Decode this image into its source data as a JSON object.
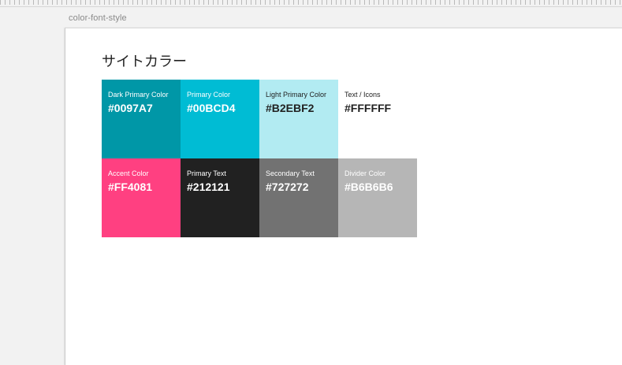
{
  "canvas": {
    "label": "color-font-style"
  },
  "artboard": {
    "title": "サイトカラー"
  },
  "swatches": [
    {
      "name": "Dark Primary Color",
      "hex": "#0097A7",
      "color": "#0097A7"
    },
    {
      "name": "Primary Color",
      "hex": "#00BCD4",
      "color": "#00BCD4"
    },
    {
      "name": "Light Primary Color",
      "hex": "#B2EBF2",
      "color": "#B2EBF2"
    },
    {
      "name": "Text / Icons",
      "hex": "#FFFFFF",
      "color": "#FFFFFF"
    },
    {
      "name": "Accent Color",
      "hex": "#FF4081",
      "color": "#FF4081"
    },
    {
      "name": "Primary Text",
      "hex": "#212121",
      "color": "#212121"
    },
    {
      "name": "Secondary Text",
      "hex": "#727272",
      "color": "#727272"
    },
    {
      "name": "Divider Color",
      "hex": "#B6B6B6",
      "color": "#B6B6B6"
    }
  ]
}
